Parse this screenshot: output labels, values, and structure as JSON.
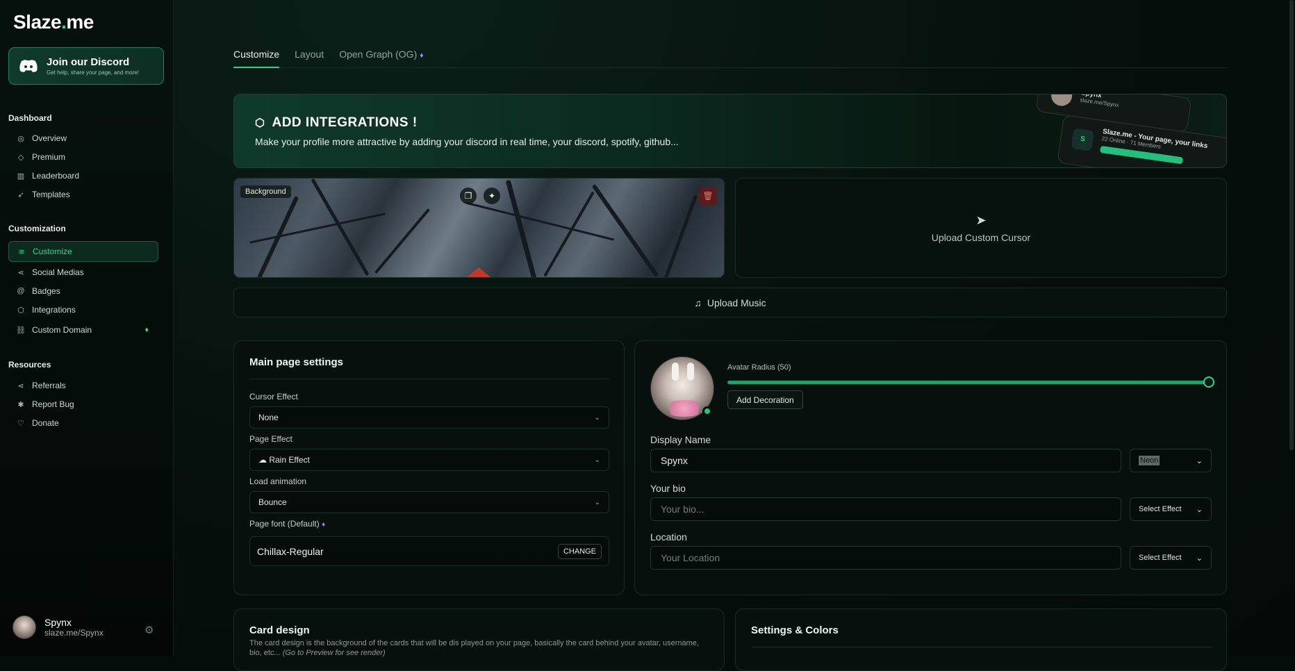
{
  "sidebar": {
    "logo_main": "Slaze",
    "logo_dot": ".",
    "logo_tld": "me",
    "discord": {
      "title": "Join our Discord",
      "subtitle": "Get help, share your page, and more!",
      "icon": "discord-icon"
    },
    "sections": {
      "dashboard": "Dashboard",
      "customization": "Customization",
      "resources": "Resources"
    },
    "dashboard_items": [
      {
        "label": "Overview",
        "icon": "target-icon"
      },
      {
        "label": "Premium",
        "icon": "diamond-icon"
      },
      {
        "label": "Leaderboard",
        "icon": "bar-chart-icon"
      },
      {
        "label": "Templates",
        "icon": "rocket-icon"
      }
    ],
    "customization_items": [
      {
        "label": "Customize",
        "icon": "sliders-icon",
        "active": true
      },
      {
        "label": "Social Medias",
        "icon": "share-icon"
      },
      {
        "label": "Badges",
        "icon": "at-icon"
      },
      {
        "label": "Integrations",
        "icon": "box-icon"
      },
      {
        "label": "Custom Domain",
        "icon": "link-icon",
        "premium": true
      }
    ],
    "resource_items": [
      {
        "label": "Referrals",
        "icon": "share-icon"
      },
      {
        "label": "Report Bug",
        "icon": "bug-icon"
      },
      {
        "label": "Donate",
        "icon": "donate-icon"
      }
    ],
    "user": {
      "name": "Spynx",
      "handle": "slaze.me/Spynx"
    }
  },
  "tabs": [
    {
      "label": "Customize",
      "active": true
    },
    {
      "label": "Layout"
    },
    {
      "label": "Open Graph (OG)",
      "premium": true
    }
  ],
  "banner": {
    "title": "ADD INTEGRATIONS !",
    "text": "Make your profile more attractive by adding your discord in real time, your discord, spotify, github...",
    "card1_name": "Spynx",
    "card1_handle": "slaze.me/Spynx",
    "card2_title": "Slaze.me - Your page, your links",
    "card2_stats": "22 Online · 71 Members"
  },
  "background": {
    "label": "Background"
  },
  "cursor": {
    "label": "Upload Custom Cursor"
  },
  "music": {
    "label": "Upload Music"
  },
  "main_settings": {
    "title": "Main page settings",
    "cursor_effect_label": "Cursor Effect",
    "cursor_effect_value": "None",
    "page_effect_label": "Page Effect",
    "page_effect_value": "Rain Effect",
    "load_animation_label": "Load animation",
    "load_animation_value": "Bounce",
    "font_label": "Page font (Default)",
    "font_value": "Chillax-Regular",
    "font_change": "CHANGE"
  },
  "profile": {
    "avatar_radius_label": "Avatar Radius (50)",
    "avatar_radius_value": 50,
    "add_decoration": "Add Decoration",
    "display_name_label": "Display Name",
    "display_name_value": "Spynx",
    "display_name_effect": "Neon",
    "bio_label": "Your bio",
    "bio_placeholder": "Your bio...",
    "bio_effect": "Select Effect",
    "location_label": "Location",
    "location_placeholder": "Your Location",
    "location_effect": "Select Effect"
  },
  "card_design": {
    "title": "Card design",
    "text": "The card design is the background of the cards that will be dis played on your page, basically the card behind your avatar, username, bio, etc...",
    "note": "(Go to Preview for see render)"
  },
  "settings_colors": {
    "title": "Settings & Colors"
  },
  "colors": {
    "accent": "#2bd48e",
    "premium": "#a679f5",
    "danger": "#5b1b1b"
  }
}
